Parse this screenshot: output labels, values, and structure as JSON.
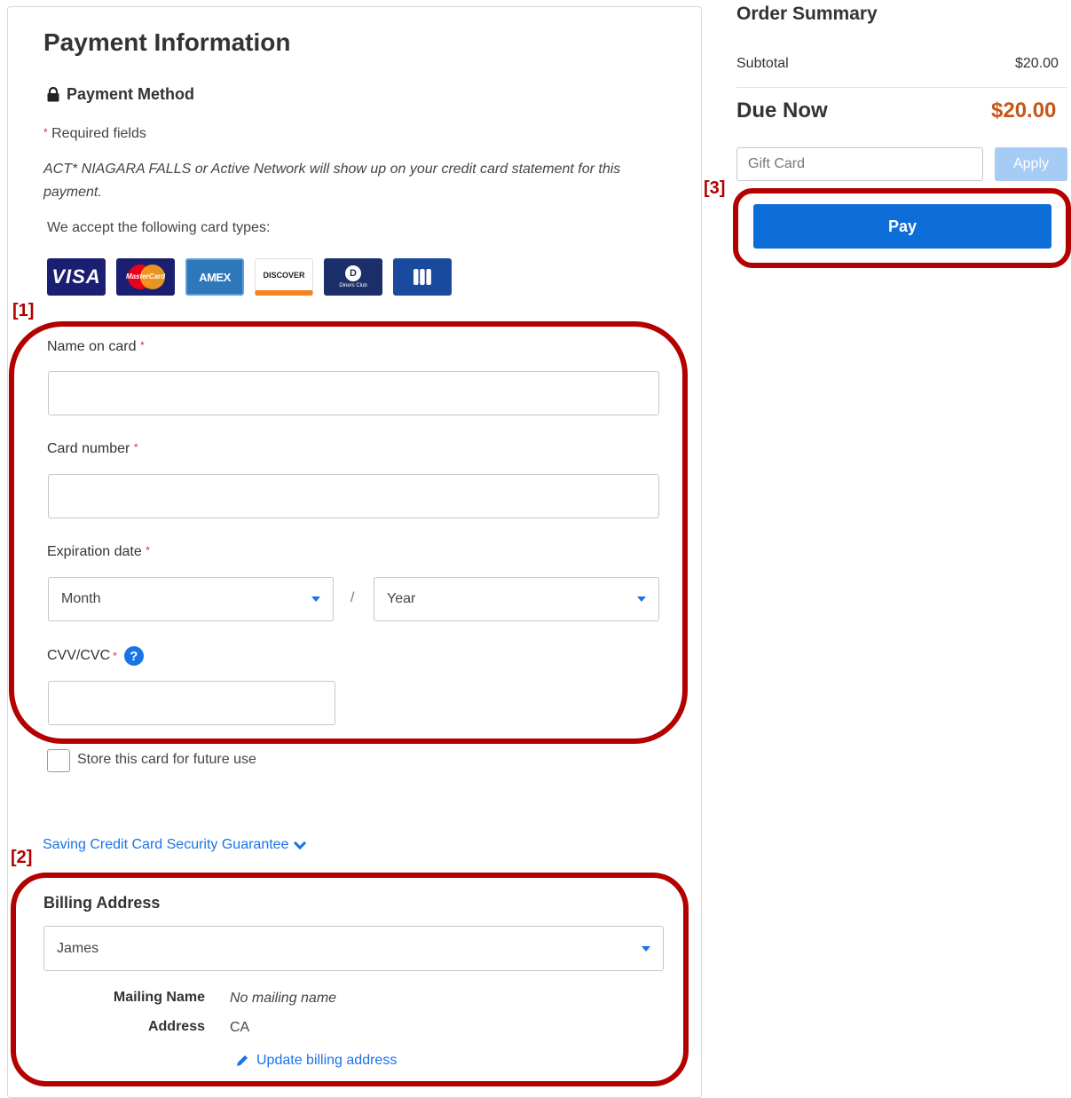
{
  "payment": {
    "title": "Payment Information",
    "method_label": "Payment Method",
    "required_note": "Required fields",
    "statement_note": "ACT* NIAGARA FALLS or Active Network will show up on your credit card statement for this payment.",
    "accept_label": "We accept the following card types:",
    "cards": {
      "visa": "VISA",
      "mastercard": "MasterCard",
      "amex": "AMEX",
      "discover": "DISCOVER",
      "diners": "Diners Club",
      "jcb": "JCB"
    },
    "form": {
      "name_label": "Name on card",
      "name_value": "",
      "card_number_label": "Card number",
      "card_number_value": "",
      "expiration_label": "Expiration date",
      "month_value": "Month",
      "slash": "/",
      "year_value": "Year",
      "cvv_label": "CVV/CVC",
      "cvv_value": "",
      "required_marker": "*",
      "help_glyph": "?"
    },
    "store_card_label": "Store this card for future use",
    "guarantee_link": "Saving Credit Card Security Guarantee"
  },
  "billing": {
    "title": "Billing Address",
    "selected": "James",
    "mailing_name_label": "Mailing Name",
    "mailing_name_value": "No mailing name",
    "address_label": "Address",
    "address_value": "CA",
    "update_link": "Update billing address"
  },
  "order_summary": {
    "title": "Order Summary",
    "subtotal_label": "Subtotal",
    "subtotal_value": "$20.00",
    "due_label": "Due Now",
    "due_value": "$20.00",
    "gift_placeholder": "Gift Card",
    "apply_label": "Apply",
    "pay_label": "Pay"
  },
  "annotations": {
    "tag1": "[1]",
    "tag2": "[2]",
    "tag3": "[3]"
  },
  "colors": {
    "accent": "#1a73e8",
    "pay_button": "#0d6dd9",
    "due_amount": "#c5571a",
    "annotation": "#b30000"
  }
}
